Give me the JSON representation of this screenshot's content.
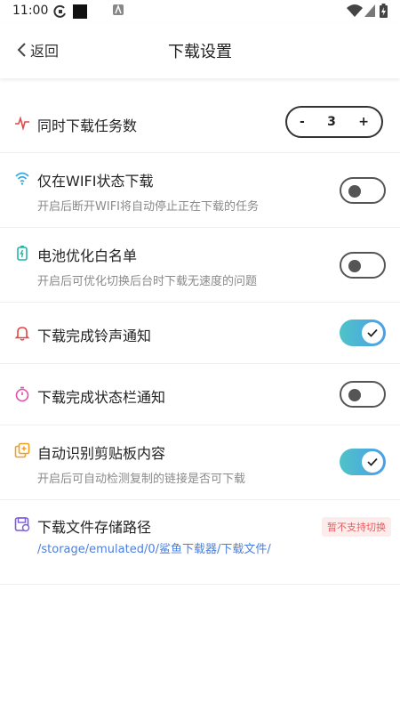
{
  "status_bar": {
    "time": "11:00"
  },
  "header": {
    "back_label": "返回",
    "title": "下载设置"
  },
  "settings": {
    "concurrent": {
      "label": "同时下载任务数",
      "minus": "-",
      "value": "3",
      "plus": "+"
    },
    "wifi_only": {
      "label": "仅在WIFI状态下载",
      "sub": "开启后断开WIFI将自动停止正在下载的任务",
      "enabled": false
    },
    "battery": {
      "label": "电池优化白名单",
      "sub": "开启后可优化切换后台时下载无速度的问题",
      "enabled": false
    },
    "ringtone": {
      "label": "下载完成铃声通知",
      "enabled": true
    },
    "statusbar_notify": {
      "label": "下载完成状态栏通知",
      "enabled": false
    },
    "clipboard": {
      "label": "自动识别剪贴板内容",
      "sub": "开启后可自动检测复制的链接是否可下载",
      "enabled": true
    },
    "storage": {
      "label": "下载文件存储路径",
      "badge": "暂不支持切换",
      "path": "/storage/emulated/0/鲨鱼下载器/下载文件/"
    }
  },
  "colors": {
    "accent_start": "#4fc3c8",
    "accent_end": "#4a9ee8",
    "path_blue": "#4a7fe0",
    "badge_red": "#e95a5a"
  }
}
